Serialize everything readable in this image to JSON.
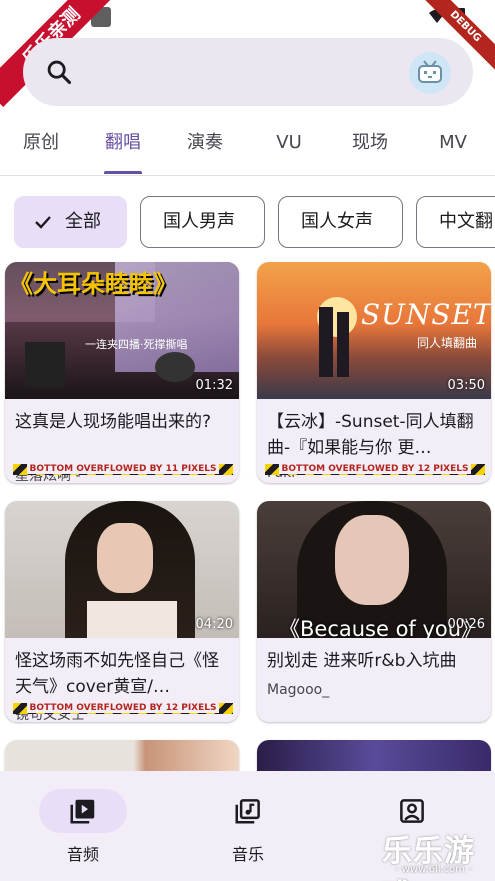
{
  "status": {
    "ribbon_text": "乐乐亲测",
    "debug_text": "DEBUG"
  },
  "search": {
    "icon": "search-icon",
    "avatar_icon": "tv-mascot-icon"
  },
  "tabs": [
    {
      "label": "原创"
    },
    {
      "label": "翻唱",
      "active": true
    },
    {
      "label": "演奏"
    },
    {
      "label": "VU"
    },
    {
      "label": "现场"
    },
    {
      "label": "MV"
    }
  ],
  "chips": [
    {
      "label": "全部",
      "selected": true
    },
    {
      "label": "国人男声"
    },
    {
      "label": "国人女声"
    },
    {
      "label": "中文翻"
    }
  ],
  "cards": [
    {
      "title": "这真是人现场能唱出来的?",
      "author": "星落炫啊 -",
      "duration": "01:32",
      "overflow": "BOTTOM OVERFLOWED BY 11 PIXELS",
      "thumb_text": "《大耳朵睦睦》",
      "thumb_caption": "一连夹四播·死撑撕唱"
    },
    {
      "title": "【云冰】-Sunset-同人填翻曲-『如果能与你 更…",
      "author": "Fuki",
      "duration": "03:50",
      "overflow": "BOTTOM OVERFLOWED BY 12 PIXELS",
      "thumb_text": "SUNSET",
      "thumb_caption": "同人填翻曲"
    },
    {
      "title": "怪这场雨不如先怪自己《怪天气》cover黄宣/…",
      "author": "镜句又女士",
      "duration": "04:20",
      "overflow": "BOTTOM OVERFLOWED BY 12 PIXELS"
    },
    {
      "title": "别划走 进来听r&b入坑曲",
      "author": "Magooo_",
      "duration": "00:26",
      "thumb_text": "《Because of you》"
    }
  ],
  "bottom_nav": [
    {
      "label": "音频",
      "icon": "video-library-icon",
      "active": true
    },
    {
      "label": "音乐",
      "icon": "music-library-icon"
    },
    {
      "label": "",
      "icon": "profile-icon"
    }
  ],
  "watermark": {
    "text": "乐乐游戏",
    "sub": "- www.6ll.com -"
  },
  "colors": {
    "primary": "#6750a4",
    "secondary_container": "#e8def8",
    "surface": "#f3edf7"
  }
}
